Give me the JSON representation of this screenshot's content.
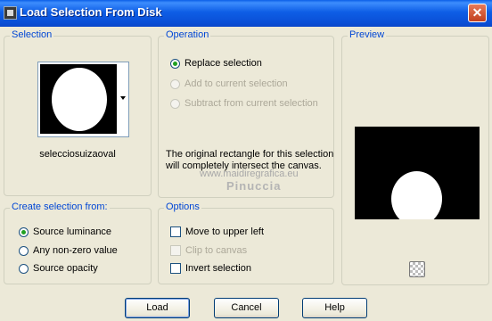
{
  "window": {
    "title": "Load Selection From Disk",
    "close_glyph": "✕",
    "app_icon": "psp-selection-icon",
    "close_icon": "close-icon"
  },
  "selection_group": {
    "label": "Selection",
    "selection_name": "selecciosuizaoval",
    "thumbnail": "oval-selection-thumbnail"
  },
  "operation_group": {
    "label": "Operation",
    "options": [
      {
        "label": "Replace selection",
        "checked": true,
        "enabled": true
      },
      {
        "label": "Add to current selection",
        "checked": false,
        "enabled": false
      },
      {
        "label": "Subtract from current selection",
        "checked": false,
        "enabled": false
      }
    ],
    "description": "The original rectangle for this selection will completely intersect the canvas.",
    "watermark": "Pinuccia",
    "watermark_url": "www.maidiregrafica.eu"
  },
  "preview_group": {
    "label": "Preview",
    "background_toggle_icon": "checkerboard-icon"
  },
  "create_group": {
    "label": "Create selection from:",
    "options": [
      {
        "label": "Source luminance",
        "checked": true
      },
      {
        "label": "Any non-zero value",
        "checked": false
      },
      {
        "label": "Source opacity",
        "checked": false
      }
    ]
  },
  "options_group": {
    "label": "Options",
    "items": [
      {
        "label": "Move to upper left",
        "checked": false,
        "enabled": true
      },
      {
        "label": "Clip to canvas",
        "checked": false,
        "enabled": false
      },
      {
        "label": "Invert selection",
        "checked": false,
        "enabled": true
      }
    ]
  },
  "buttons": {
    "load": "Load",
    "cancel": "Cancel",
    "help": "Help"
  },
  "colors": {
    "titlebar": "#0a5ee8",
    "dialog_bg": "#ece9d8",
    "group_label": "#0046d5",
    "radio_dot": "#21a121"
  }
}
